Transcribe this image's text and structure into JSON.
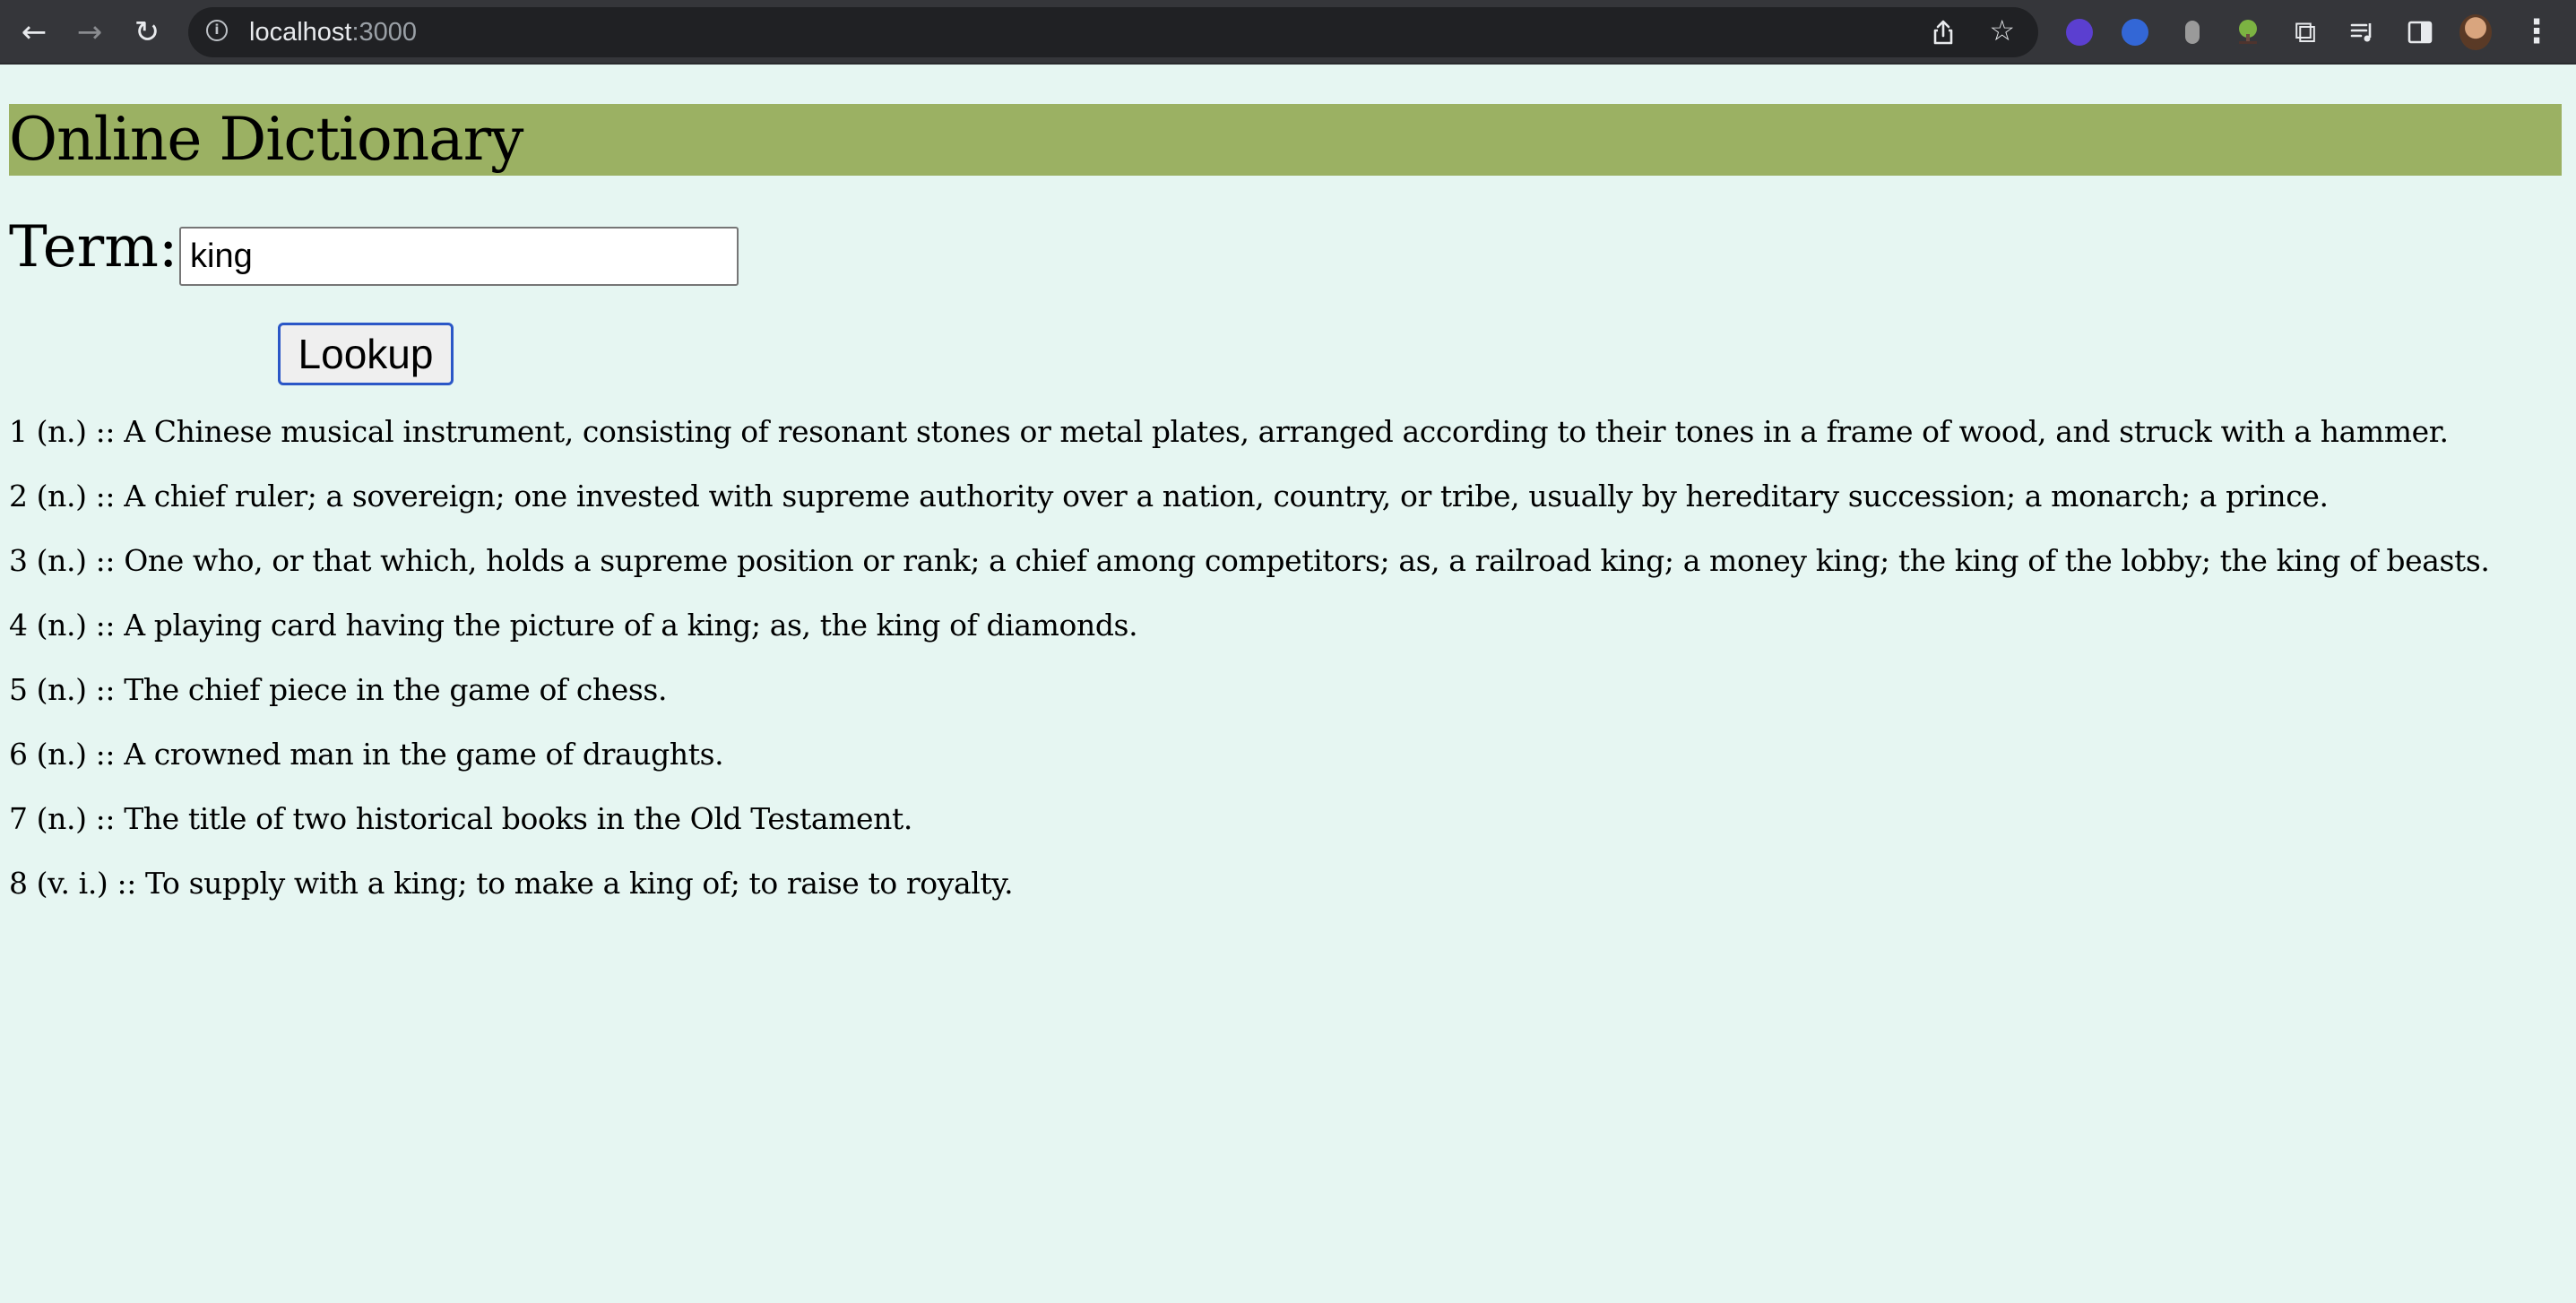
{
  "browser": {
    "url_host": "localhost",
    "url_port": ":3000",
    "icons": {
      "back": "back-arrow-icon",
      "forward": "forward-arrow-icon",
      "reload": "reload-icon",
      "info": "site-info-icon",
      "share": "share-icon",
      "bookmark": "star-icon",
      "extensions": [
        "brain-extension-icon",
        "docs-extension-icon",
        "gray-extension-icon",
        "tree-extension-icon",
        "puzzle-extensions-icon",
        "media-queue-icon",
        "side-panel-icon",
        "profile-avatar",
        "chrome-menu-icon"
      ]
    },
    "glyphs": {
      "back": "←",
      "forward": "→",
      "reload": "↻",
      "info": "i",
      "star": "☆",
      "puzzle": "⧉",
      "menu": "⋮"
    }
  },
  "page": {
    "title": "Online Dictionary",
    "colors": {
      "background": "#e6f6f2",
      "title_bar": "#9bb163",
      "button_border": "#2b57c7"
    },
    "form": {
      "term_label": "Term:",
      "term_value": "king",
      "lookup_label": "Lookup"
    },
    "definitions": [
      "1 (n.) :: A Chinese musical instrument, consisting of resonant stones or metal plates, arranged according to their tones in a frame of wood, and struck with a hammer.",
      "2 (n.) :: A chief ruler; a sovereign; one invested with supreme authority over a nation, country, or tribe, usually by hereditary succession; a monarch; a prince.",
      "3 (n.) :: One who, or that which, holds a supreme position or rank; a chief among competitors; as, a railroad king; a money king; the king of the lobby; the king of beasts.",
      "4 (n.) :: A playing card having the picture of a king; as, the king of diamonds.",
      "5 (n.) :: The chief piece in the game of chess.",
      "6 (n.) :: A crowned man in the game of draughts.",
      "7 (n.) :: The title of two historical books in the Old Testament.",
      "8 (v. i.) :: To supply with a king; to make a king of; to raise to royalty."
    ]
  }
}
